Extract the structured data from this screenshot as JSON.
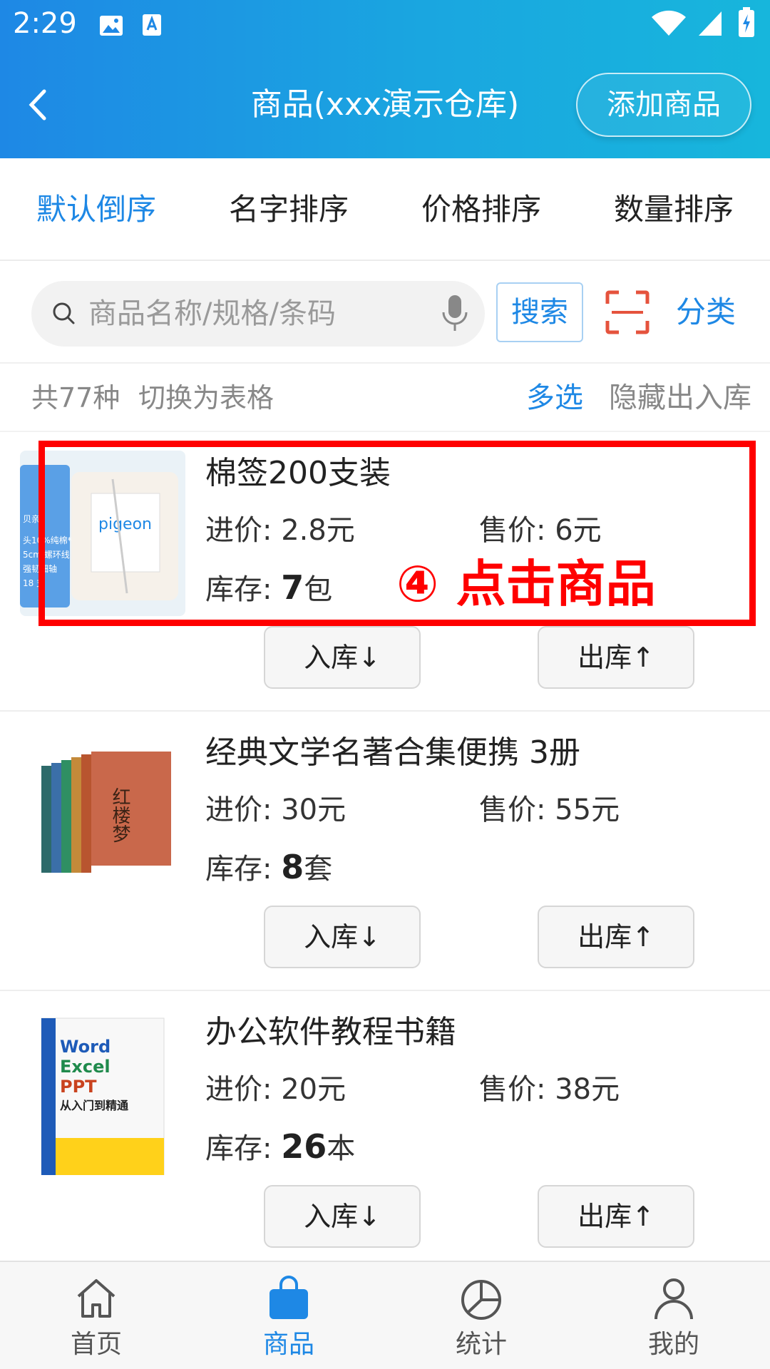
{
  "status": {
    "time": "2:29"
  },
  "header": {
    "title": "商品(xxx演示仓库)",
    "add_label": "添加商品"
  },
  "sort_tabs": [
    {
      "label": "默认倒序",
      "active": true
    },
    {
      "label": "名字排序",
      "active": false
    },
    {
      "label": "价格排序",
      "active": false
    },
    {
      "label": "数量排序",
      "active": false
    }
  ],
  "search": {
    "placeholder": "商品名称/规格/条码",
    "button": "搜索",
    "category": "分类"
  },
  "info": {
    "count": "共77种",
    "toggle": "切换为表格",
    "multi": "多选",
    "hide": "隐藏出入库"
  },
  "products": [
    {
      "name": "棉签200支装",
      "cost": "进价: 2.8元",
      "price": "售价: 6元",
      "stock_label": "库存:",
      "stock_num": "7",
      "stock_unit": "包",
      "in": "入库↓",
      "out": "出库↑"
    },
    {
      "name": "经典文学名著合集便携 3册",
      "cost": "进价: 30元",
      "price": "售价: 55元",
      "stock_label": "库存:",
      "stock_num": "8",
      "stock_unit": "套",
      "in": "入库↓",
      "out": "出库↑"
    },
    {
      "name": "办公软件教程书籍",
      "cost": "进价: 20元",
      "price": "售价: 38元",
      "stock_label": "库存:",
      "stock_num": "26",
      "stock_unit": "本",
      "in": "入库↓",
      "out": "出库↑"
    }
  ],
  "annotation": {
    "text": "④ 点击商品"
  },
  "thumb_text": {
    "cotton_brand": "pigeon",
    "cotton_lines": [
      "贝亲",
      "头10%纯棉*",
      "5cm 螺环线",
      "强韧细轴",
      "18 支"
    ],
    "novel_title": "红楼梦",
    "office_lines": [
      "Word",
      "Excel",
      "PPT",
      "从入门到精通"
    ]
  },
  "bottom_nav": [
    {
      "label": "首页",
      "icon": "home-icon",
      "active": false
    },
    {
      "label": "商品",
      "icon": "shopping-bag-icon",
      "active": true
    },
    {
      "label": "统计",
      "icon": "pie-chart-icon",
      "active": false
    },
    {
      "label": "我的",
      "icon": "user-icon",
      "active": false
    }
  ],
  "colors": {
    "primary": "#1e88e5",
    "header_start": "#1e88e5",
    "header_end": "#17b6dc",
    "annotation": "#ff0000"
  }
}
